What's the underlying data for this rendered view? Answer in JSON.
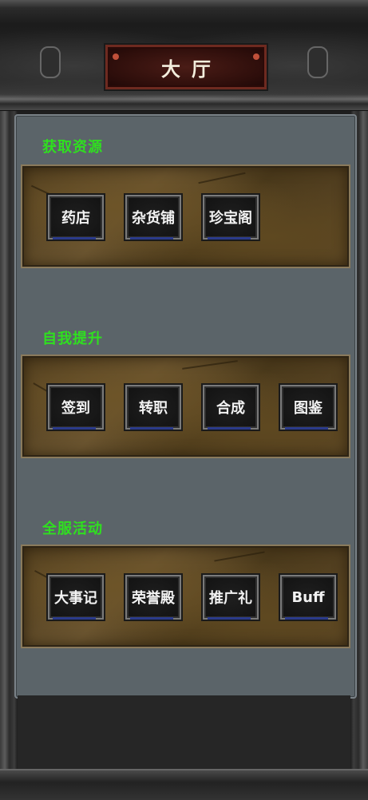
{
  "header": {
    "title": "大厅"
  },
  "sections": [
    {
      "title": "获取资源",
      "buttons": [
        "药店",
        "杂货铺",
        "珍宝阁"
      ]
    },
    {
      "title": "自我提升",
      "buttons": [
        "签到",
        "转职",
        "合成",
        "图鉴"
      ]
    },
    {
      "title": "全服活动",
      "buttons": [
        "大事记",
        "荣誉殿",
        "推广礼",
        "Buff"
      ]
    }
  ],
  "colors": {
    "section_title": "#2fe01f",
    "panel": "#5b6469",
    "title_plate": "#4a1c16"
  }
}
